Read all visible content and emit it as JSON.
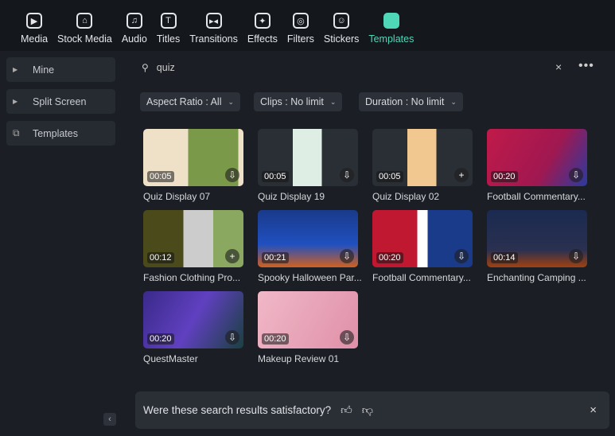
{
  "toolbar": {
    "items": [
      {
        "label": "Media",
        "icon": "media-icon",
        "glyph": "▶"
      },
      {
        "label": "Stock Media",
        "icon": "stock-media-icon",
        "glyph": "⌂"
      },
      {
        "label": "Audio",
        "icon": "audio-icon",
        "glyph": "♫"
      },
      {
        "label": "Titles",
        "icon": "titles-icon",
        "glyph": "T"
      },
      {
        "label": "Transitions",
        "icon": "transitions-icon",
        "glyph": "▸◂"
      },
      {
        "label": "Effects",
        "icon": "effects-icon",
        "glyph": "✦"
      },
      {
        "label": "Filters",
        "icon": "filters-icon",
        "glyph": "◎"
      },
      {
        "label": "Stickers",
        "icon": "stickers-icon",
        "glyph": "☺"
      },
      {
        "label": "Templates",
        "icon": "templates-icon",
        "glyph": "▭"
      }
    ],
    "active": "Templates",
    "accent": "#4fd8b8"
  },
  "sidebar": {
    "items": [
      {
        "label": "Mine"
      },
      {
        "label": "Split Screen"
      },
      {
        "label": "Templates"
      }
    ],
    "collapse": "‹"
  },
  "search": {
    "value": "quiz",
    "clear": "×",
    "more": "•••"
  },
  "filters": [
    {
      "label": "Aspect Ratio : All"
    },
    {
      "label": "Clips : No limit"
    },
    {
      "label": "Duration : No limit"
    }
  ],
  "templates": [
    {
      "title": "Quiz Display 07",
      "duration": "00:05",
      "action": "download"
    },
    {
      "title": "Quiz Display 19",
      "duration": "00:05",
      "action": "download"
    },
    {
      "title": "Quiz Display 02",
      "duration": "00:05",
      "action": "add"
    },
    {
      "title": "Football Commentary...",
      "duration": "00:20",
      "action": "download"
    },
    {
      "title": "Fashion Clothing Pro...",
      "duration": "00:12",
      "action": "add"
    },
    {
      "title": "Spooky Halloween Par...",
      "duration": "00:21",
      "action": "download"
    },
    {
      "title": "Football Commentary...",
      "duration": "00:20",
      "action": "download"
    },
    {
      "title": "Enchanting Camping ...",
      "duration": "00:14",
      "action": "download"
    },
    {
      "title": "QuestMaster",
      "duration": "00:20",
      "action": "download"
    },
    {
      "title": "Makeup Review 01",
      "duration": "00:20",
      "action": "download"
    }
  ],
  "feedback": {
    "question": "Were these search results satisfactory?",
    "close": "×"
  }
}
